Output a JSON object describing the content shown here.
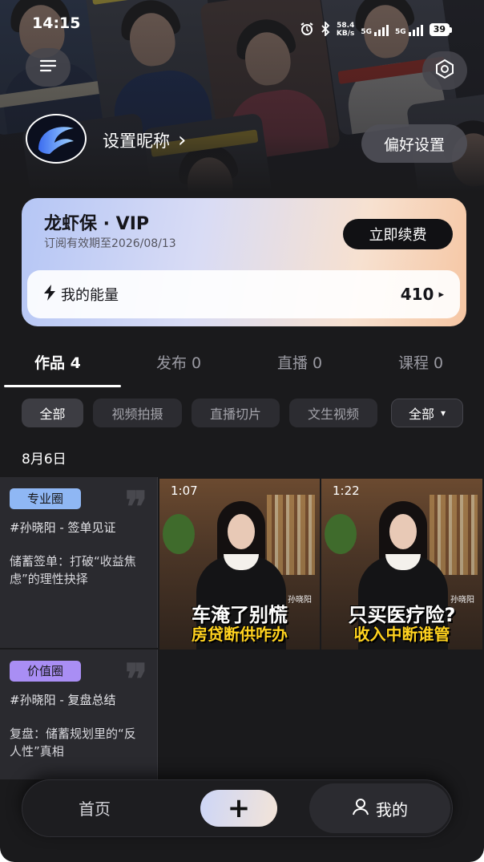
{
  "status_bar": {
    "time": "14:15",
    "net_speed_value": "58.4",
    "net_speed_unit": "KB/s",
    "sim1": "5G",
    "sim2": "5G",
    "battery": "39"
  },
  "profile": {
    "nickname": "设置昵称",
    "nickname_arrow": "›",
    "preferences_label": "偏好设置"
  },
  "vip": {
    "title": "龙虾保 · VIP",
    "expiry": "订阅有效期至2026/08/13",
    "renew_label": "立即续费",
    "energy_label": "我的能量",
    "energy_value": "410",
    "energy_arrow": "▸"
  },
  "tabs": [
    {
      "label": "作品 4"
    },
    {
      "label": "发布 0"
    },
    {
      "label": "直播 0"
    },
    {
      "label": "课程 0"
    }
  ],
  "filters": [
    {
      "label": "全部"
    },
    {
      "label": "视频拍摄"
    },
    {
      "label": "直播切片"
    },
    {
      "label": "文生视频"
    }
  ],
  "filter_dropdown": {
    "label": "全部",
    "arrow": "▾"
  },
  "date_group": "8月6日",
  "text_cards": [
    {
      "badge": "专业圈",
      "tag": "#孙晓阳 - 签单见证",
      "desc": "储蓄签单：打破“收益焦虑”的理性抉择"
    },
    {
      "badge": "价值圈",
      "tag": "#孙晓阳 - 复盘总结",
      "desc": "复盘：储蓄规划里的“反人性”真相"
    }
  ],
  "videos": [
    {
      "duration": "1:07",
      "presenter": "孙晓阳",
      "caption_main": "车淹了别慌",
      "caption_sub": "房贷断供咋办"
    },
    {
      "duration": "1:22",
      "presenter": "孙晓阳",
      "caption_main": "只买医疗险?",
      "caption_sub": "收入中断谁管"
    }
  ],
  "bottom_nav": {
    "home_label": "首页",
    "add_symbol": "+",
    "mine_label": "我的"
  },
  "colors": {
    "background": "#1a1a1c",
    "badge_pro": "#8fb7f4",
    "badge_value": "#a98ef4",
    "caption_yellow": "#ffd21f",
    "renew_button": "#111114"
  },
  "icons": [
    "menu-icon",
    "scan-icon",
    "alarm-icon",
    "bluetooth-icon",
    "signal-icon",
    "battery-icon",
    "lightning-icon",
    "user-icon",
    "plus-icon",
    "quote-icon",
    "chevron-right-icon",
    "play-arrow-icon",
    "caret-down-icon"
  ]
}
